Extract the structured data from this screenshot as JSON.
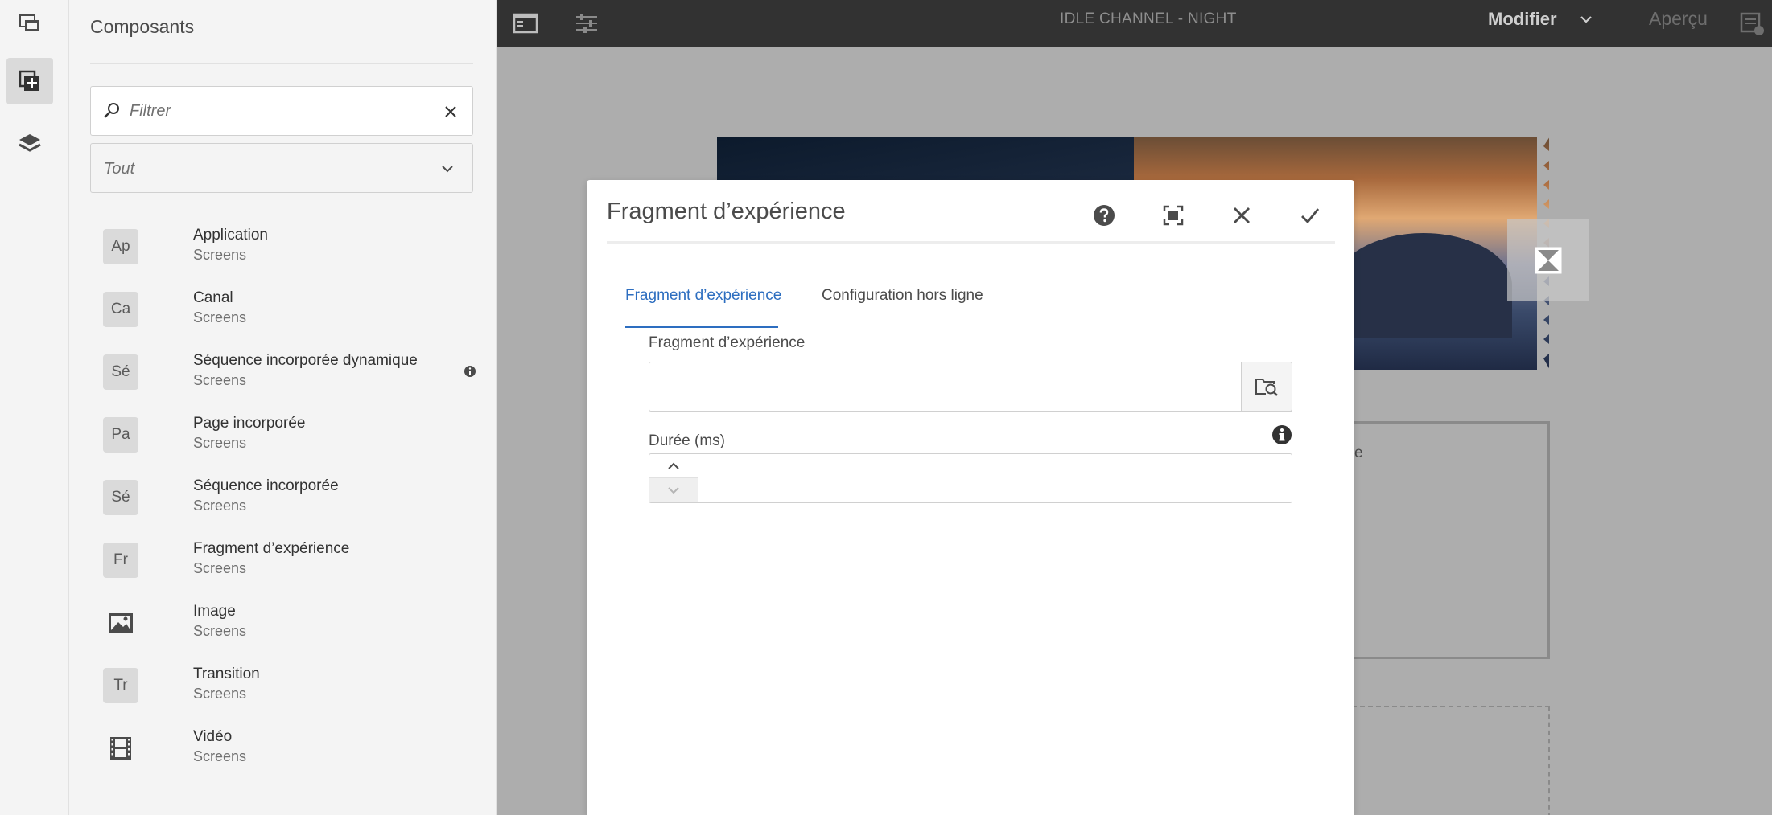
{
  "panel": {
    "title": "Composants",
    "filter_placeholder": "Filtrer",
    "group_select": "Tout",
    "components": [
      {
        "badge": "Ap",
        "name": "Application",
        "group": "Screens"
      },
      {
        "badge": "Ca",
        "name": "Canal",
        "group": "Screens"
      },
      {
        "badge": "Sé",
        "name": "Séquence incorporée dynamique",
        "group": "Screens",
        "has_info": true
      },
      {
        "badge": "Pa",
        "name": "Page incorporée",
        "group": "Screens"
      },
      {
        "badge": "Sé",
        "name": "Séquence incorporée",
        "group": "Screens"
      },
      {
        "badge": "Fr",
        "name": "Fragment d’expérience",
        "group": "Screens"
      },
      {
        "badge": "",
        "icon": "image-icon",
        "name": "Image",
        "group": "Screens"
      },
      {
        "badge": "Tr",
        "name": "Transition",
        "group": "Screens"
      },
      {
        "badge": "",
        "icon": "film-icon",
        "name": "Vidéo",
        "group": "Screens"
      }
    ]
  },
  "topbar": {
    "page_title": "IDLE CHANNEL - NIGHT",
    "mode": "Modifier",
    "preview": "Aperçu"
  },
  "canvas": {
    "box_text": "e"
  },
  "dialog": {
    "title": "Fragment d’expérience",
    "tabs": [
      {
        "label": "Fragment d’expérience",
        "active": true
      },
      {
        "label": "Configuration hors ligne",
        "active": false
      }
    ],
    "fields": {
      "fragment_label": "Fragment d’expérience",
      "fragment_value": "",
      "duration_label": "Durée (ms)",
      "duration_value": ""
    }
  },
  "colors": {
    "accent": "#2d6ec0",
    "topbar_bg": "#323232",
    "canvas_bg": "#adadad",
    "panel_bg": "#f4f4f4"
  }
}
